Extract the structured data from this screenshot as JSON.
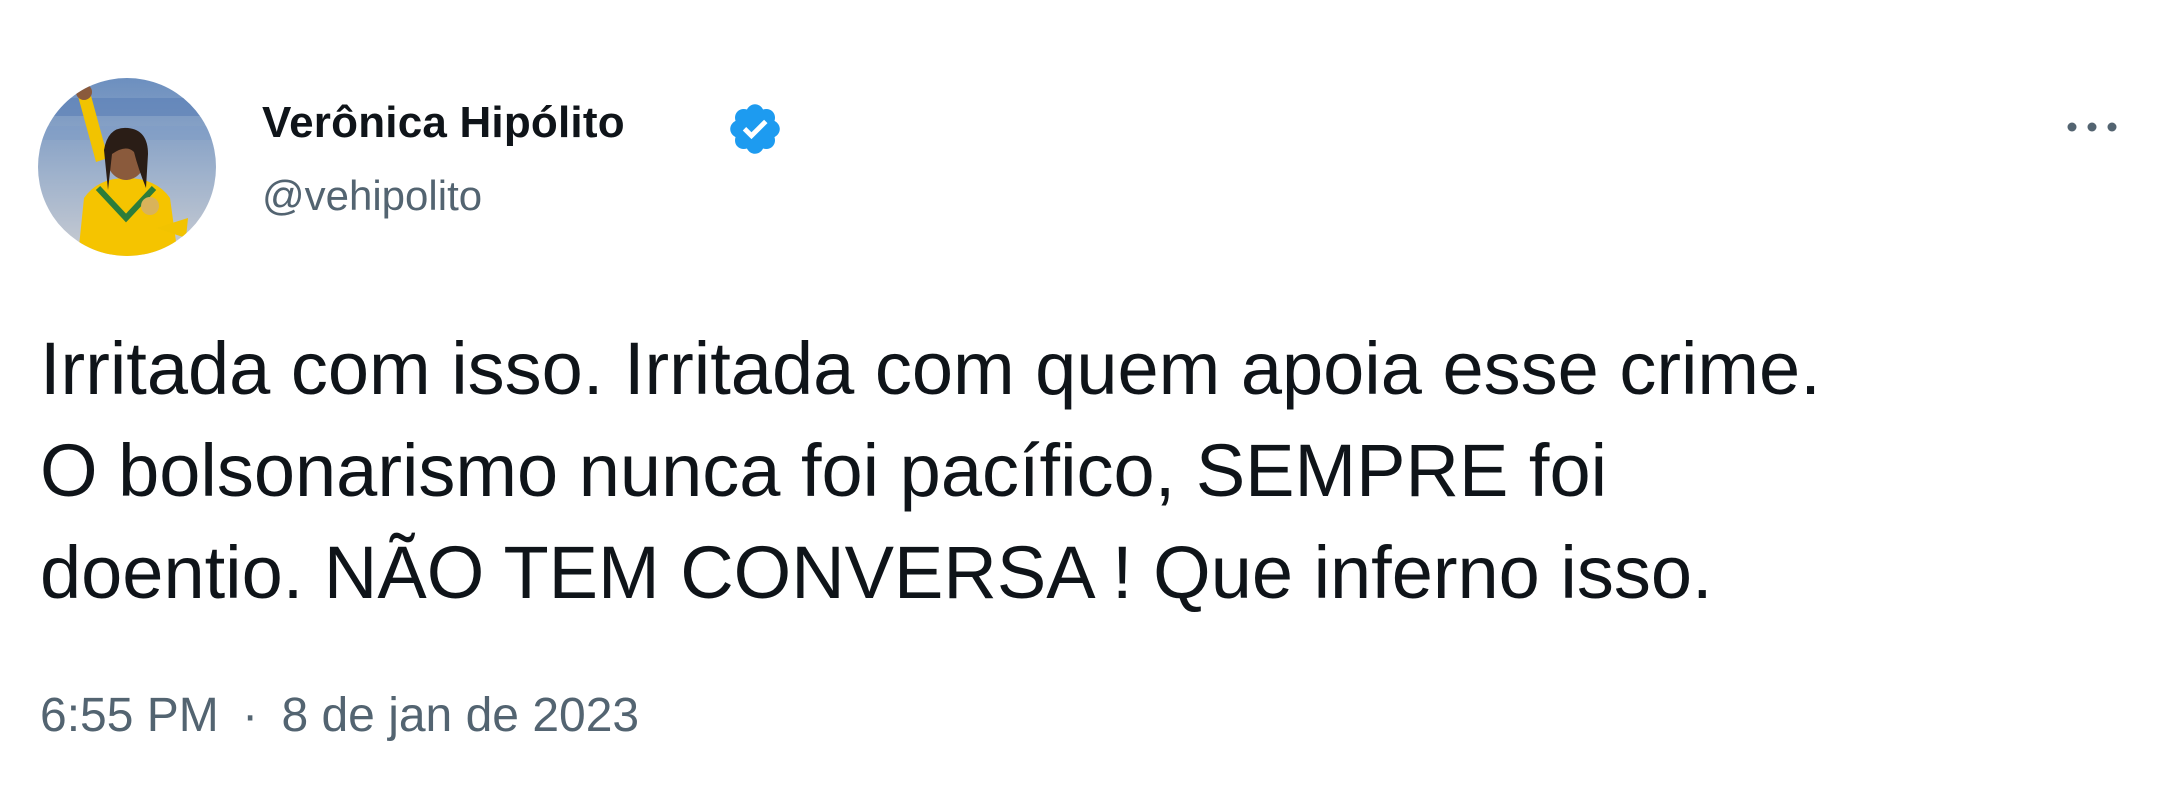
{
  "author": {
    "display_name": "Verônica Hipólito",
    "handle": "@vehipolito",
    "verified": true,
    "avatar_icon": "profile-photo"
  },
  "tweet": {
    "text_lines": [
      "Irritada com isso. Irritada com quem apoia esse crime.",
      "O bolsonarismo nunca foi pacífico, SEMPRE foi",
      "doentio. NÃO TEM CONVERSA ! Que inferno isso."
    ],
    "time": "6:55 PM",
    "separator": "·",
    "date": "8 de jan de 2023"
  },
  "actions": {
    "more_icon": "more-horizontal-icon"
  },
  "colors": {
    "text_primary": "#0f1419",
    "text_secondary": "#536471",
    "verified_blue": "#1d9bf0",
    "background": "#ffffff"
  }
}
